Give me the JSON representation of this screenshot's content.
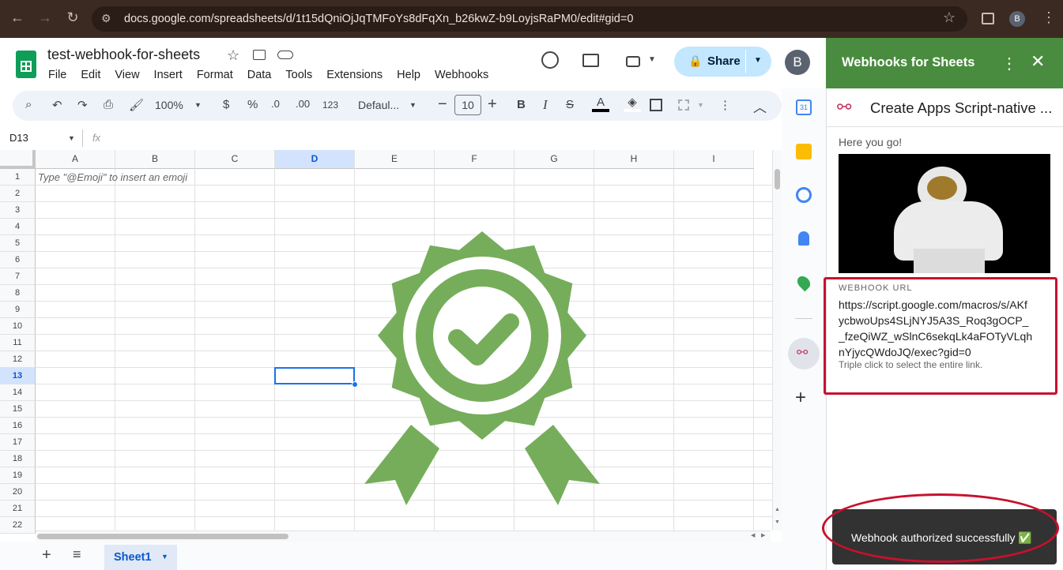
{
  "browser": {
    "url": "docs.google.com/spreadsheets/d/1t15dQniOjJqTMFoYs8dFqXn_b26kwZ-b9LoyjsRaPM0/edit#gid=0",
    "profile_initial": "B"
  },
  "doc": {
    "title": "test-webhook-for-sheets",
    "menu": [
      "File",
      "Edit",
      "View",
      "Insert",
      "Format",
      "Data",
      "Tools",
      "Extensions",
      "Help",
      "Webhooks"
    ],
    "share_label": "Share",
    "avatar": "B"
  },
  "toolbar": {
    "zoom": "100%",
    "currency": "$",
    "percent": "%",
    "dec_less": ".0",
    "dec_more": ".00",
    "format123": "123",
    "font": "Defaul...",
    "font_size": "10",
    "bold": "B",
    "italic": "I"
  },
  "formula_bar": {
    "cell_ref": "D13",
    "fx": "fx"
  },
  "grid": {
    "columns": [
      "A",
      "B",
      "C",
      "D",
      "E",
      "F",
      "G",
      "H",
      "I"
    ],
    "rows": [
      "1",
      "2",
      "3",
      "4",
      "5",
      "6",
      "7",
      "8",
      "9",
      "10",
      "11",
      "12",
      "13",
      "14",
      "15",
      "16",
      "17",
      "18",
      "19",
      "20",
      "21",
      "22"
    ],
    "a1_hint": "Type \"@Emoji\" to insert an emoji",
    "active_col": "D",
    "active_row": "13"
  },
  "sheet_tab": {
    "name": "Sheet1"
  },
  "colors": {
    "accent_green": "#4a8c3f",
    "badge_green": "#76ad5b",
    "highlight_red": "#c8102e"
  },
  "panel": {
    "title": "Webhooks for Sheets",
    "card_title": "Create Apps Script-native ...",
    "greeting": "Here you go!",
    "url_label": "WEBHOOK URL",
    "url_value": "https://script.google.com/macros/s/AKfycbwoUps4SLjNYJ5A3S_Roq3gOCP_ _fzeQiWZ_wSlnC6sekqLk4aFOTyVLqh nYjycQWdoJQ/exec?gid=0",
    "url_lines": [
      "https://script.google.com/macros/s/AKf",
      "ycbwoUps4SLjNYJ5A3S_Roq3gOCP_",
      "_fzeQiWZ_wSlnC6sekqLk4aFOTyVLqh",
      "nYjycQWdoJQ/exec?gid=0"
    ],
    "url_hint": "Triple click to select the entire link."
  },
  "toast": {
    "message": "Webhook authorized successfully ✅"
  }
}
